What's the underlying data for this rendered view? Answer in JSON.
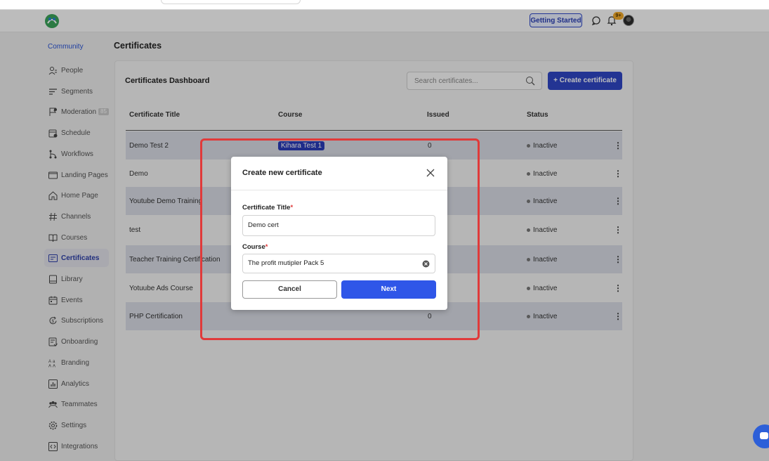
{
  "topbar": {
    "getting_started": "Getting Started",
    "notification_badge": "9+"
  },
  "sidebar": {
    "community": "Community",
    "items": [
      {
        "label": "People",
        "icon": "people-icon"
      },
      {
        "label": "Segments",
        "icon": "segments-icon"
      },
      {
        "label": "Moderation",
        "icon": "moderation-icon",
        "count": "85"
      },
      {
        "label": "Schedule",
        "icon": "schedule-icon"
      },
      {
        "label": "Workflows",
        "icon": "workflows-icon"
      },
      {
        "label": "Landing Pages",
        "icon": "landing-pages-icon"
      },
      {
        "label": "Home Page",
        "icon": "home-icon"
      },
      {
        "label": "Channels",
        "icon": "hash-icon"
      },
      {
        "label": "Courses",
        "icon": "book-icon"
      },
      {
        "label": "Certificates",
        "icon": "certificate-icon",
        "active": true
      },
      {
        "label": "Library",
        "icon": "library-icon"
      },
      {
        "label": "Events",
        "icon": "calendar-icon"
      },
      {
        "label": "Subscriptions",
        "icon": "subscriptions-icon"
      },
      {
        "label": "Onboarding",
        "icon": "onboarding-icon"
      },
      {
        "label": "Branding",
        "icon": "branding-icon"
      },
      {
        "label": "Analytics",
        "icon": "analytics-icon"
      },
      {
        "label": "Teammates",
        "icon": "teammates-icon"
      },
      {
        "label": "Settings",
        "icon": "gear-icon"
      },
      {
        "label": "Integrations",
        "icon": "integrations-icon"
      }
    ]
  },
  "page": {
    "title": "Certificates",
    "dashboard_title": "Certificates Dashboard",
    "search_placeholder": "Search certificates...",
    "create_button": "+ Create certificate"
  },
  "table": {
    "headers": [
      "Certificate Title",
      "Course",
      "Issued",
      "Status"
    ],
    "rows": [
      {
        "title": "Demo Test 2",
        "course": "Kihara Test 1",
        "issued": "0",
        "status": "Inactive"
      },
      {
        "title": "Demo",
        "course": "",
        "issued": "",
        "status": "Inactive"
      },
      {
        "title": "Youtube Demo Training",
        "course": "",
        "issued": "",
        "status": "Inactive"
      },
      {
        "title": "test",
        "course": "",
        "issued": "",
        "status": "Inactive"
      },
      {
        "title": "Teacher Training Certification",
        "course": "",
        "issued": "",
        "status": "Inactive"
      },
      {
        "title": "Yotuube Ads Course",
        "course": "",
        "issued": "",
        "status": "Inactive"
      },
      {
        "title": "PHP Certification",
        "course": "",
        "issued": "0",
        "status": "Inactive"
      }
    ]
  },
  "modal": {
    "title": "Create new certificate",
    "certificate_title_label": "Certificate Title",
    "certificate_title_value": "Demo cert",
    "course_label": "Course",
    "course_value": "The profit mutipler Pack 5",
    "required_mark": "*",
    "cancel": "Cancel",
    "next": "Next"
  },
  "colors": {
    "accent": "#2f46c5",
    "highlight": "#e03a3a",
    "next_button": "#2f56e8"
  }
}
